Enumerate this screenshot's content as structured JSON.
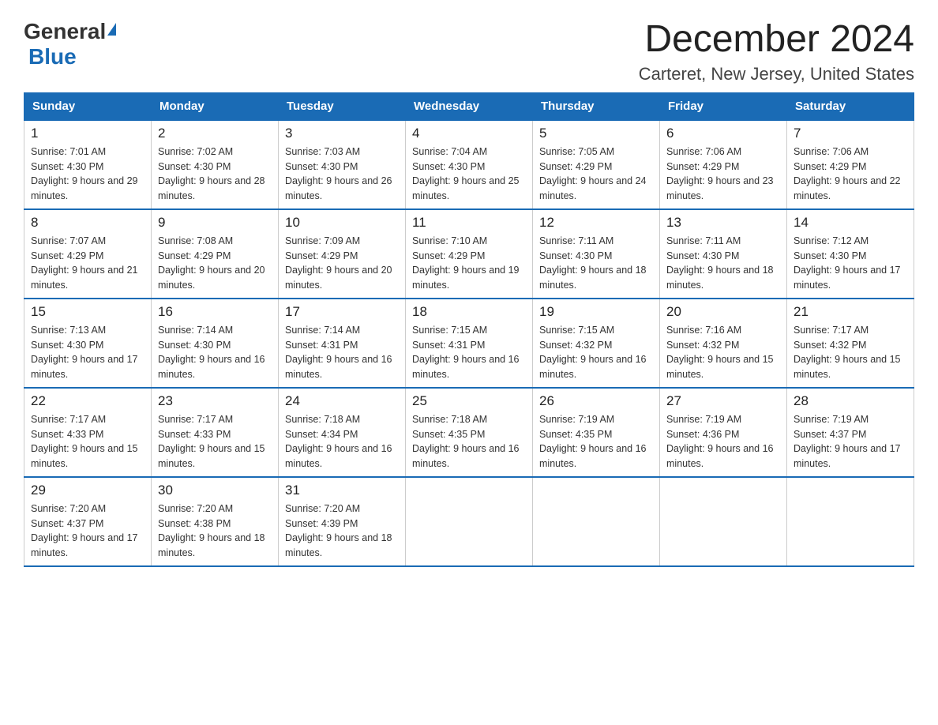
{
  "header": {
    "logo": {
      "general_text": "General",
      "blue_text": "Blue"
    },
    "title": "December 2024",
    "subtitle": "Carteret, New Jersey, United States"
  },
  "calendar": {
    "days_of_week": [
      "Sunday",
      "Monday",
      "Tuesday",
      "Wednesday",
      "Thursday",
      "Friday",
      "Saturday"
    ],
    "weeks": [
      [
        {
          "day": "1",
          "sunrise": "Sunrise: 7:01 AM",
          "sunset": "Sunset: 4:30 PM",
          "daylight": "Daylight: 9 hours and 29 minutes."
        },
        {
          "day": "2",
          "sunrise": "Sunrise: 7:02 AM",
          "sunset": "Sunset: 4:30 PM",
          "daylight": "Daylight: 9 hours and 28 minutes."
        },
        {
          "day": "3",
          "sunrise": "Sunrise: 7:03 AM",
          "sunset": "Sunset: 4:30 PM",
          "daylight": "Daylight: 9 hours and 26 minutes."
        },
        {
          "day": "4",
          "sunrise": "Sunrise: 7:04 AM",
          "sunset": "Sunset: 4:30 PM",
          "daylight": "Daylight: 9 hours and 25 minutes."
        },
        {
          "day": "5",
          "sunrise": "Sunrise: 7:05 AM",
          "sunset": "Sunset: 4:29 PM",
          "daylight": "Daylight: 9 hours and 24 minutes."
        },
        {
          "day": "6",
          "sunrise": "Sunrise: 7:06 AM",
          "sunset": "Sunset: 4:29 PM",
          "daylight": "Daylight: 9 hours and 23 minutes."
        },
        {
          "day": "7",
          "sunrise": "Sunrise: 7:06 AM",
          "sunset": "Sunset: 4:29 PM",
          "daylight": "Daylight: 9 hours and 22 minutes."
        }
      ],
      [
        {
          "day": "8",
          "sunrise": "Sunrise: 7:07 AM",
          "sunset": "Sunset: 4:29 PM",
          "daylight": "Daylight: 9 hours and 21 minutes."
        },
        {
          "day": "9",
          "sunrise": "Sunrise: 7:08 AM",
          "sunset": "Sunset: 4:29 PM",
          "daylight": "Daylight: 9 hours and 20 minutes."
        },
        {
          "day": "10",
          "sunrise": "Sunrise: 7:09 AM",
          "sunset": "Sunset: 4:29 PM",
          "daylight": "Daylight: 9 hours and 20 minutes."
        },
        {
          "day": "11",
          "sunrise": "Sunrise: 7:10 AM",
          "sunset": "Sunset: 4:29 PM",
          "daylight": "Daylight: 9 hours and 19 minutes."
        },
        {
          "day": "12",
          "sunrise": "Sunrise: 7:11 AM",
          "sunset": "Sunset: 4:30 PM",
          "daylight": "Daylight: 9 hours and 18 minutes."
        },
        {
          "day": "13",
          "sunrise": "Sunrise: 7:11 AM",
          "sunset": "Sunset: 4:30 PM",
          "daylight": "Daylight: 9 hours and 18 minutes."
        },
        {
          "day": "14",
          "sunrise": "Sunrise: 7:12 AM",
          "sunset": "Sunset: 4:30 PM",
          "daylight": "Daylight: 9 hours and 17 minutes."
        }
      ],
      [
        {
          "day": "15",
          "sunrise": "Sunrise: 7:13 AM",
          "sunset": "Sunset: 4:30 PM",
          "daylight": "Daylight: 9 hours and 17 minutes."
        },
        {
          "day": "16",
          "sunrise": "Sunrise: 7:14 AM",
          "sunset": "Sunset: 4:30 PM",
          "daylight": "Daylight: 9 hours and 16 minutes."
        },
        {
          "day": "17",
          "sunrise": "Sunrise: 7:14 AM",
          "sunset": "Sunset: 4:31 PM",
          "daylight": "Daylight: 9 hours and 16 minutes."
        },
        {
          "day": "18",
          "sunrise": "Sunrise: 7:15 AM",
          "sunset": "Sunset: 4:31 PM",
          "daylight": "Daylight: 9 hours and 16 minutes."
        },
        {
          "day": "19",
          "sunrise": "Sunrise: 7:15 AM",
          "sunset": "Sunset: 4:32 PM",
          "daylight": "Daylight: 9 hours and 16 minutes."
        },
        {
          "day": "20",
          "sunrise": "Sunrise: 7:16 AM",
          "sunset": "Sunset: 4:32 PM",
          "daylight": "Daylight: 9 hours and 15 minutes."
        },
        {
          "day": "21",
          "sunrise": "Sunrise: 7:17 AM",
          "sunset": "Sunset: 4:32 PM",
          "daylight": "Daylight: 9 hours and 15 minutes."
        }
      ],
      [
        {
          "day": "22",
          "sunrise": "Sunrise: 7:17 AM",
          "sunset": "Sunset: 4:33 PM",
          "daylight": "Daylight: 9 hours and 15 minutes."
        },
        {
          "day": "23",
          "sunrise": "Sunrise: 7:17 AM",
          "sunset": "Sunset: 4:33 PM",
          "daylight": "Daylight: 9 hours and 15 minutes."
        },
        {
          "day": "24",
          "sunrise": "Sunrise: 7:18 AM",
          "sunset": "Sunset: 4:34 PM",
          "daylight": "Daylight: 9 hours and 16 minutes."
        },
        {
          "day": "25",
          "sunrise": "Sunrise: 7:18 AM",
          "sunset": "Sunset: 4:35 PM",
          "daylight": "Daylight: 9 hours and 16 minutes."
        },
        {
          "day": "26",
          "sunrise": "Sunrise: 7:19 AM",
          "sunset": "Sunset: 4:35 PM",
          "daylight": "Daylight: 9 hours and 16 minutes."
        },
        {
          "day": "27",
          "sunrise": "Sunrise: 7:19 AM",
          "sunset": "Sunset: 4:36 PM",
          "daylight": "Daylight: 9 hours and 16 minutes."
        },
        {
          "day": "28",
          "sunrise": "Sunrise: 7:19 AM",
          "sunset": "Sunset: 4:37 PM",
          "daylight": "Daylight: 9 hours and 17 minutes."
        }
      ],
      [
        {
          "day": "29",
          "sunrise": "Sunrise: 7:20 AM",
          "sunset": "Sunset: 4:37 PM",
          "daylight": "Daylight: 9 hours and 17 minutes."
        },
        {
          "day": "30",
          "sunrise": "Sunrise: 7:20 AM",
          "sunset": "Sunset: 4:38 PM",
          "daylight": "Daylight: 9 hours and 18 minutes."
        },
        {
          "day": "31",
          "sunrise": "Sunrise: 7:20 AM",
          "sunset": "Sunset: 4:39 PM",
          "daylight": "Daylight: 9 hours and 18 minutes."
        },
        null,
        null,
        null,
        null
      ]
    ]
  }
}
